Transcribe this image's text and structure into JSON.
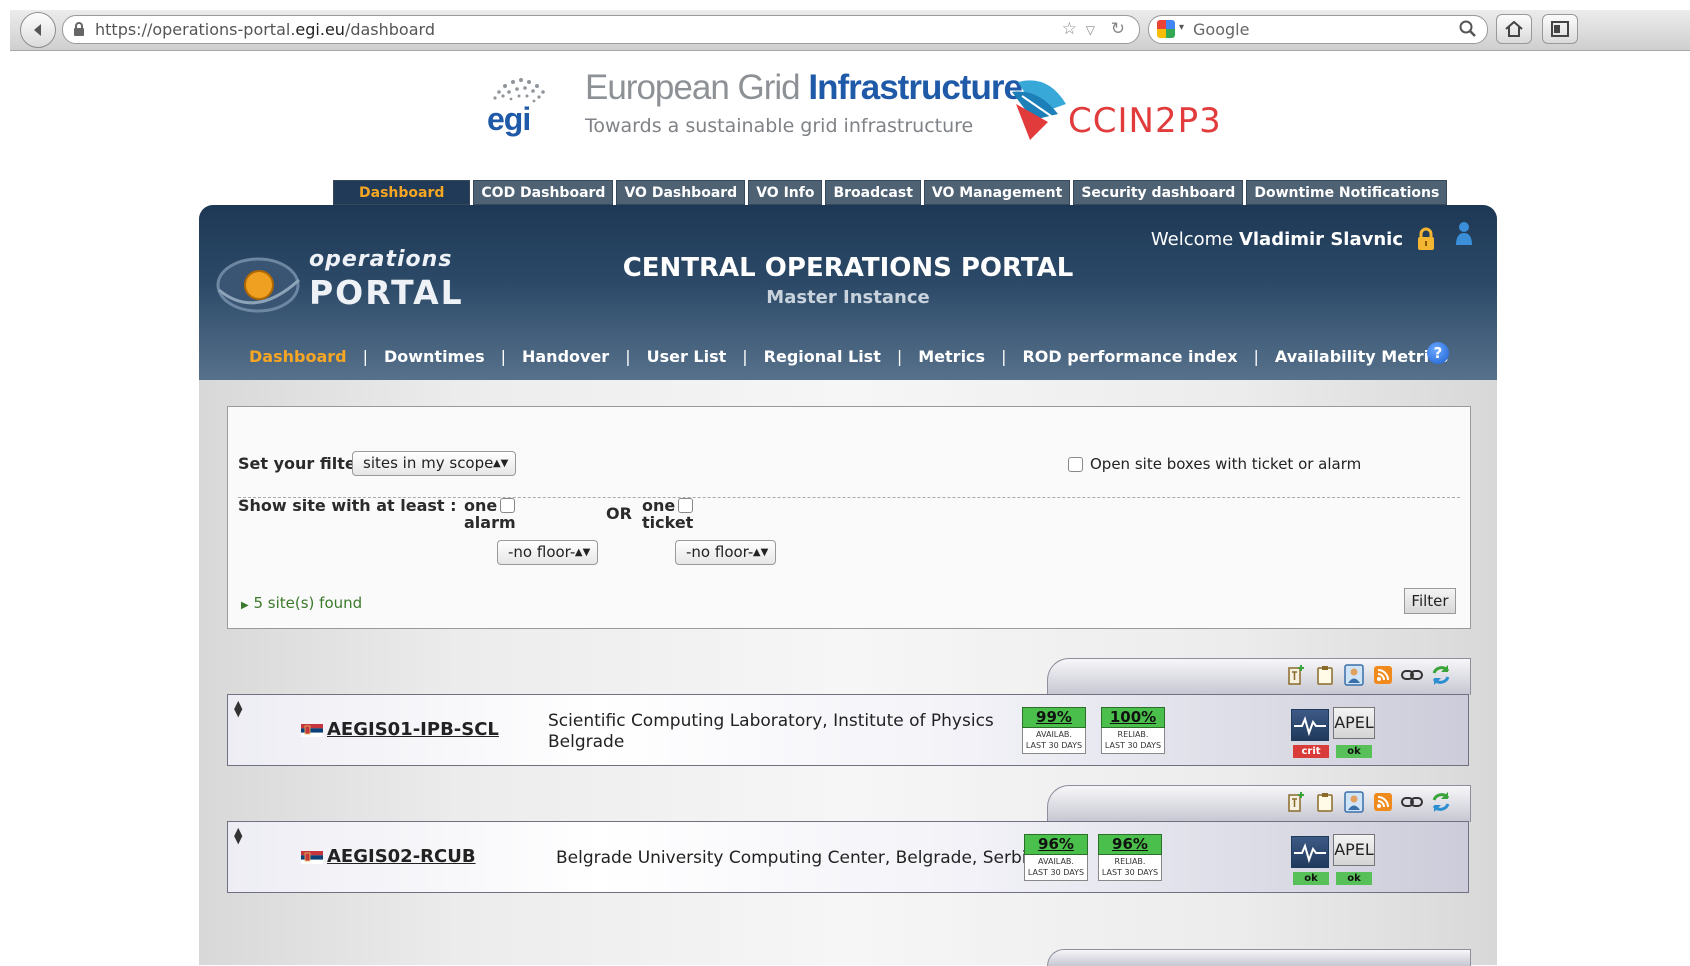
{
  "browser": {
    "url_prefix": "https://operations-portal.",
    "url_domain": "egi.eu",
    "url_path": "/dashboard",
    "search_placeholder": "Google"
  },
  "header": {
    "egi_title_light": "European Grid ",
    "egi_title_strong": "Infrastructure",
    "egi_subtitle": "Towards a sustainable grid infrastructure",
    "cc_text": "CCIN2P3"
  },
  "top_tabs": [
    "Dashboard",
    "COD Dashboard",
    "VO Dashboard",
    "VO Info",
    "Broadcast",
    "VO Management",
    "Security dashboard",
    "Downtime Notifications"
  ],
  "portal": {
    "logo_line1": "operations",
    "logo_line2": "PORTAL",
    "title": "CENTRAL OPERATIONS PORTAL",
    "subtitle": "Master Instance",
    "welcome_prefix": "Welcome ",
    "user_name": "Vladimir Slavnic",
    "help": "?"
  },
  "main_nav": [
    "Dashboard",
    "Downtimes",
    "Handover",
    "User List",
    "Regional List",
    "Metrics",
    "ROD performance index",
    "Availability Metrics"
  ],
  "filter": {
    "set_label": "Set your filter",
    "scope_value": "sites in my scope",
    "open_boxes_label": "Open site boxes with ticket or alarm",
    "show_label": "Show site with at least :",
    "one_label": "one",
    "alarm_label": "alarm",
    "or_label": "OR",
    "ticket_label": "ticket",
    "floor_value": "-no floor-",
    "found": "5 site(s) found",
    "filter_button": "Filter"
  },
  "sites": [
    {
      "name": "AEGIS01-IPB-SCL",
      "desc_line1": "Scientific Computing Laboratory, Institute of Physics",
      "desc_line2": "Belgrade",
      "availability": "99%",
      "reliability": "100%",
      "avail_caption1": "AVAILAB.",
      "reliab_caption1": "RELIAB.",
      "caption2": "LAST 30 DAYS",
      "apel": "APEL",
      "status1": "crit",
      "status2": "ok"
    },
    {
      "name": "AEGIS02-RCUB",
      "desc_line1": "Belgrade University Computing Center, Belgrade, Serbia",
      "desc_line2": "",
      "availability": "96%",
      "reliability": "96%",
      "avail_caption1": "AVAILAB.",
      "reliab_caption1": "RELIAB.",
      "caption2": "LAST 30 DAYS",
      "apel": "APEL",
      "status1": "ok",
      "status2": "ok"
    }
  ]
}
